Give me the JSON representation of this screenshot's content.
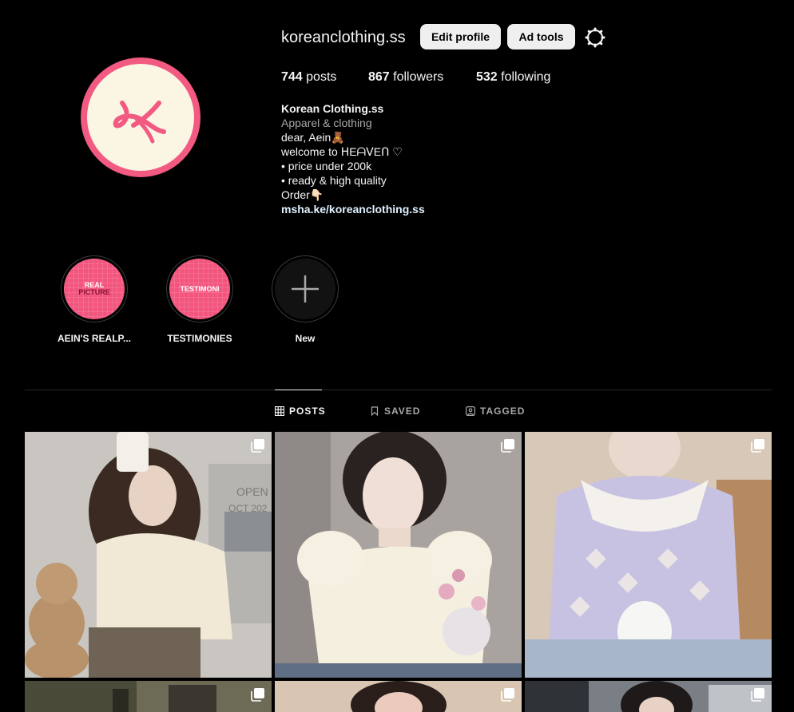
{
  "profile": {
    "username": "koreanclothing.ss",
    "edit_profile_label": "Edit profile",
    "ad_tools_label": "Ad tools",
    "settings_icon": "gear-icon",
    "stats": {
      "posts_count": "744",
      "posts_label": "posts",
      "followers_count": "867",
      "followers_label": "followers",
      "following_count": "532",
      "following_label": "following"
    },
    "bio": {
      "name": "Korean Clothing.ss",
      "category": "Apparel & clothing",
      "lines": [
        "dear, Aein🧸",
        "welcome to ᕼEᗩᐯEᑎ ♡",
        "• price under 200k",
        "• ready & high quality",
        "Order👇🏻"
      ],
      "link": "msha.ke/koreanclothing.ss"
    },
    "colors": {
      "accent_pink": "#f25a82",
      "avatar_bg": "#fbf6e4"
    }
  },
  "highlights": [
    {
      "label": "AEIN'S REALP...",
      "cover_line1": "REAL",
      "cover_line2": "PICTURE"
    },
    {
      "label": "TESTIMONIES",
      "cover_line1": "TESTIMONI"
    },
    {
      "label": "New",
      "icon": "plus-icon"
    }
  ],
  "tabs": [
    {
      "label": "POSTS",
      "icon": "grid-icon",
      "active": true
    },
    {
      "label": "SAVED",
      "icon": "bookmark-icon",
      "active": false
    },
    {
      "label": "TAGGED",
      "icon": "tag-icon",
      "active": false
    }
  ],
  "posts": [
    {
      "desc": "cream knit cardigan mirror selfie with teddy bear",
      "overlay_text": "OPEN\nOCT 202",
      "multi": true
    },
    {
      "desc": "cream cable knit puff sleeve top with flowers",
      "multi": true
    },
    {
      "desc": "lavender argyle cardigan with lace collar and bunny",
      "multi": true
    },
    {
      "desc": "post 4",
      "multi": true
    },
    {
      "desc": "post 5",
      "multi": true
    },
    {
      "desc": "post 6",
      "multi": true
    }
  ]
}
